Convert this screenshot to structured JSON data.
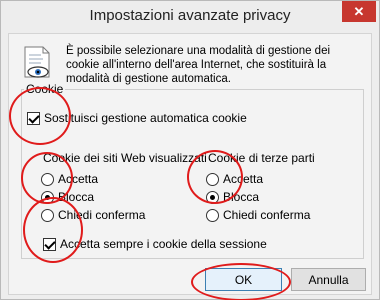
{
  "window": {
    "title": "Impostazioni avanzate privacy",
    "close_glyph": "✕"
  },
  "info": {
    "icon": "privacy-settings-icon",
    "text": "È possibile selezionare una modalità di gestione dei cookie all'interno dell'area Internet, che sostituirà la modalità di gestione automatica."
  },
  "cookie_group": {
    "legend": "Cookie",
    "override_label": "Sostituisci gestione automatica cookie",
    "override_checked": true,
    "first_party": {
      "title": "Cookie dei siti Web visualizzati",
      "options": [
        "Accetta",
        "Blocca",
        "Chiedi conferma"
      ],
      "selected": "Blocca"
    },
    "third_party": {
      "title": "Cookie di terze parti",
      "options": [
        "Accetta",
        "Blocca",
        "Chiedi conferma"
      ],
      "selected": "Blocca"
    },
    "session_label": "Accetta sempre i cookie della sessione",
    "session_checked": true
  },
  "buttons": {
    "ok": "OK",
    "cancel": "Annulla"
  },
  "colors": {
    "annotation": "#e01b1b",
    "close_button": "#c7372f"
  }
}
